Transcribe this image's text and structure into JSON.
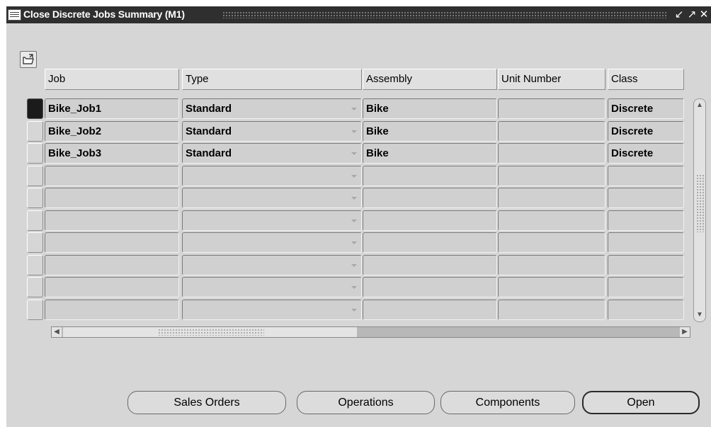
{
  "window": {
    "title": "Close Discrete Jobs Summary (M1)",
    "controls": [
      "minimize",
      "maximize",
      "close"
    ]
  },
  "toolbar": {
    "icon": "folder-open-icon"
  },
  "table": {
    "columns": [
      "Job",
      "Type",
      "Assembly",
      "Unit Number",
      "Class"
    ],
    "rows": [
      {
        "job": "Bike_Job1",
        "type": "Standard",
        "assembly": "Bike",
        "unit_number": "",
        "class": "Discrete"
      },
      {
        "job": "Bike_Job2",
        "type": "Standard",
        "assembly": "Bike",
        "unit_number": "",
        "class": "Discrete"
      },
      {
        "job": "Bike_Job3",
        "type": "Standard",
        "assembly": "Bike",
        "unit_number": "",
        "class": "Discrete"
      },
      {
        "job": "",
        "type": "",
        "assembly": "",
        "unit_number": "",
        "class": ""
      },
      {
        "job": "",
        "type": "",
        "assembly": "",
        "unit_number": "",
        "class": ""
      },
      {
        "job": "",
        "type": "",
        "assembly": "",
        "unit_number": "",
        "class": ""
      },
      {
        "job": "",
        "type": "",
        "assembly": "",
        "unit_number": "",
        "class": ""
      },
      {
        "job": "",
        "type": "",
        "assembly": "",
        "unit_number": "",
        "class": ""
      },
      {
        "job": "",
        "type": "",
        "assembly": "",
        "unit_number": "",
        "class": ""
      },
      {
        "job": "",
        "type": "",
        "assembly": "",
        "unit_number": "",
        "class": ""
      }
    ]
  },
  "buttons": {
    "sales_orders": "Sales Orders",
    "operations": "Operations",
    "components": "Components",
    "open": "Open"
  }
}
